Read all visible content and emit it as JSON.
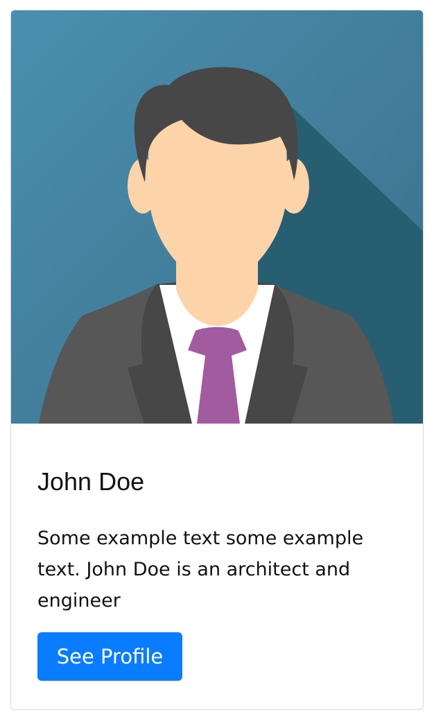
{
  "card": {
    "image_alt": "avatar",
    "title": "John Doe",
    "text": "Some example text some example text. John Doe is an architect and engineer",
    "button_label": "See Profile"
  },
  "colors": {
    "accent": "#0A7CFF",
    "background_blue": "#4A8EAF",
    "shadow": "#275E72",
    "hair": "#474747",
    "skin": "#FDD3A9",
    "suit": "#575757",
    "shirt": "#FFFFFF",
    "tie": "#A35BA0"
  }
}
